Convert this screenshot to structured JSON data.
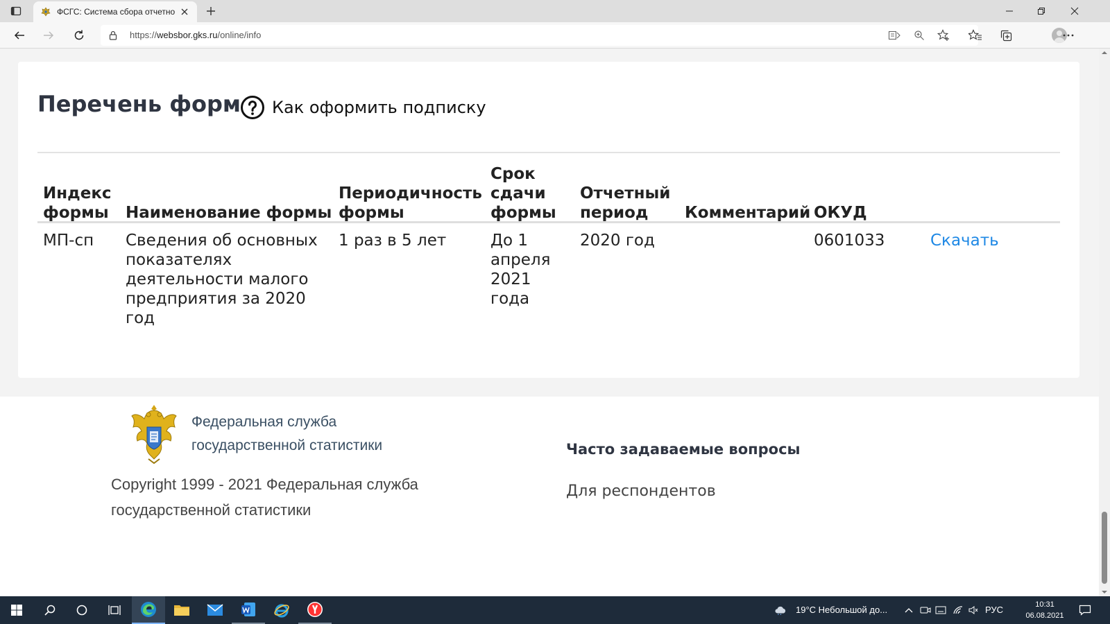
{
  "browser": {
    "tab_title": "ФСГС: Система сбора отчетност",
    "url_scheme": "https://",
    "url_host": "websbor.gks.ru",
    "url_path": "/online/info"
  },
  "page": {
    "title": "Перечень форм",
    "help_link": "Как оформить подписку",
    "table": {
      "headers": {
        "index": [
          "Индекс",
          "формы"
        ],
        "name": [
          "Наименование формы"
        ],
        "period": [
          "Периодичность",
          "формы"
        ],
        "deadline": [
          "Срок",
          "сдачи",
          "формы"
        ],
        "report": [
          "Отчетный",
          "период"
        ],
        "comment": [
          "Комментарий"
        ],
        "okud": [
          "ОКУД"
        ]
      },
      "rows": [
        {
          "index": "МП-сп",
          "name": [
            "Сведения об основных",
            "показателях",
            "деятельности малого",
            "предприятия за 2020",
            "год"
          ],
          "period": "1 раз в 5 лет",
          "deadline": [
            "До 1",
            "апреля",
            "2021",
            "года"
          ],
          "report": "2020 год",
          "comment": "",
          "okud": "0601033",
          "download": "Скачать"
        }
      ]
    }
  },
  "footer": {
    "org_name": [
      "Федеральная служба",
      "государственной статистики"
    ],
    "copyright": [
      "Copyright 1999 - 2021 Федеральная служба",
      "государственной статистики"
    ],
    "faq": "Часто задаваемые вопросы",
    "respondents": "Для респондентов"
  },
  "taskbar": {
    "weather": "19°C  Небольшой до...",
    "lang": "РУС",
    "time": "10:31",
    "date": "06.08.2021"
  },
  "colors": {
    "link": "#1e88e5",
    "heading": "#2f3542",
    "taskbar": "#1e2b3a"
  }
}
